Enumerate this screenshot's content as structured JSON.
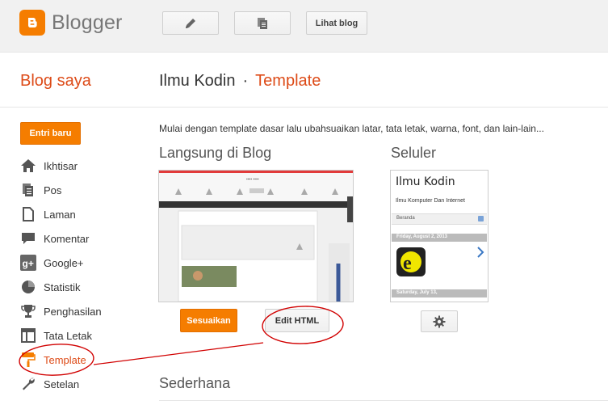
{
  "header": {
    "app_name": "Blogger",
    "view_blog_label": "Lihat blog"
  },
  "title_row": {
    "sidebar_heading": "Blog saya",
    "blog_name": "Ilmu Kodin",
    "separator": "·",
    "section": "Template"
  },
  "sidebar": {
    "new_post_label": "Entri baru",
    "items": [
      {
        "label": "Ikhtisar",
        "icon": "home-icon"
      },
      {
        "label": "Pos",
        "icon": "posts-icon"
      },
      {
        "label": "Laman",
        "icon": "page-icon"
      },
      {
        "label": "Komentar",
        "icon": "comment-icon"
      },
      {
        "label": "Google+",
        "icon": "google-plus-icon"
      },
      {
        "label": "Statistik",
        "icon": "pie-chart-icon"
      },
      {
        "label": "Penghasilan",
        "icon": "trophy-icon"
      },
      {
        "label": "Tata Letak",
        "icon": "layout-icon"
      },
      {
        "label": "Template",
        "icon": "paint-roller-icon",
        "active": true
      },
      {
        "label": "Setelan",
        "icon": "wrench-icon"
      }
    ]
  },
  "main": {
    "description": "Mulai dengan template dasar lalu ubahsuaikan latar, tata letak, warna, font, dan lain-lain...",
    "live_heading": "Langsung di Blog",
    "mobile_heading": "Seluler",
    "simple_heading": "Sederhana",
    "customize_label": "Sesuaikan",
    "edit_html_label": "Edit HTML",
    "mobile_preview": {
      "title": "Ilmu Kodin",
      "subtitle": "Ilmu Komputer Dan Internet",
      "nav_label": "Beranda",
      "date1": "Friday, August 2, 2013",
      "date2": "Saturday, July 13,"
    }
  },
  "colors": {
    "accent": "#f57d00",
    "accent_text": "#dd4b18",
    "annotation": "#d10000"
  }
}
